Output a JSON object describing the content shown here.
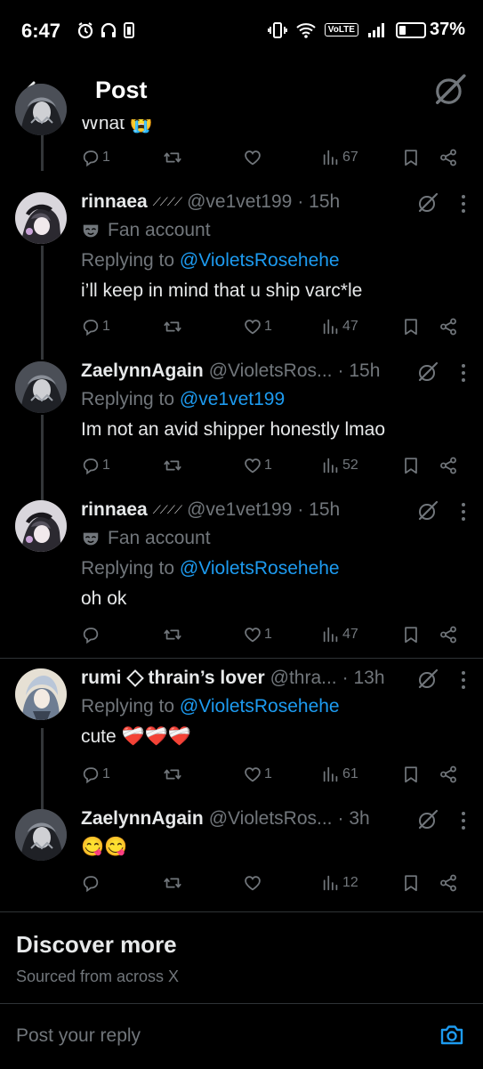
{
  "status_bar": {
    "time": "6:47",
    "volte": "VoLTE",
    "battery": "37%",
    "battery_level": 0.37
  },
  "header": {
    "title": "Post"
  },
  "partial_tweet": {
    "text": "What 😭",
    "counts": {
      "replies": "1",
      "views": "67"
    }
  },
  "tweets": [
    {
      "name": "rinnaea",
      "handle": "@ve1vet199",
      "time": "· 15h",
      "label": "Fan account",
      "replying_prefix": "Replying to ",
      "replying_to": "@VioletsRosehehe",
      "text": "i’ll keep in mind that u ship varc*le",
      "counts": {
        "replies": "1",
        "reposts": "",
        "likes": "1",
        "views": "47"
      }
    },
    {
      "name": "ZaelynnAgain",
      "handle": "@VioletsRos...",
      "time": "· 15h",
      "replying_prefix": "Replying to ",
      "replying_to": "@ve1vet199",
      "text": "Im not an avid shipper honestly lmao",
      "counts": {
        "replies": "1",
        "reposts": "",
        "likes": "1",
        "views": "52"
      }
    },
    {
      "name": "rinnaea",
      "handle": "@ve1vet199",
      "time": "· 15h",
      "label": "Fan account",
      "replying_prefix": "Replying to ",
      "replying_to": "@VioletsRosehehe",
      "text": "oh ok",
      "counts": {
        "replies": "",
        "reposts": "",
        "likes": "1",
        "views": "47"
      }
    },
    {
      "name": "rumi",
      "name_suffix": "thrain’s lover",
      "handle": "@thra...",
      "time": "· 13h",
      "replying_prefix": "Replying to ",
      "replying_to": "@VioletsRosehehe",
      "text": "cute ❤️‍🩹❤️‍🩹❤️‍🩹",
      "counts": {
        "replies": "1",
        "reposts": "",
        "likes": "1",
        "views": "61"
      }
    },
    {
      "name": "ZaelynnAgain",
      "handle": "@VioletsRos...",
      "time": "· 3h",
      "text": "😋😋",
      "counts": {
        "replies": "",
        "reposts": "",
        "likes": "",
        "views": "12"
      }
    }
  ],
  "discover": {
    "title": "Discover more",
    "subtitle": "Sourced from across X"
  },
  "reply_bar": {
    "placeholder": "Post your reply"
  },
  "colors": {
    "background": "#000000",
    "text": "#e7e9ea",
    "muted": "#71767b",
    "link": "#1d9bf0",
    "divider": "#2f3336"
  },
  "icons": [
    "back-arrow-icon",
    "grok-icon",
    "reply-icon",
    "repost-icon",
    "like-icon",
    "views-icon",
    "bookmark-icon",
    "share-icon",
    "more-icon",
    "mask-icon",
    "camera-icon"
  ]
}
